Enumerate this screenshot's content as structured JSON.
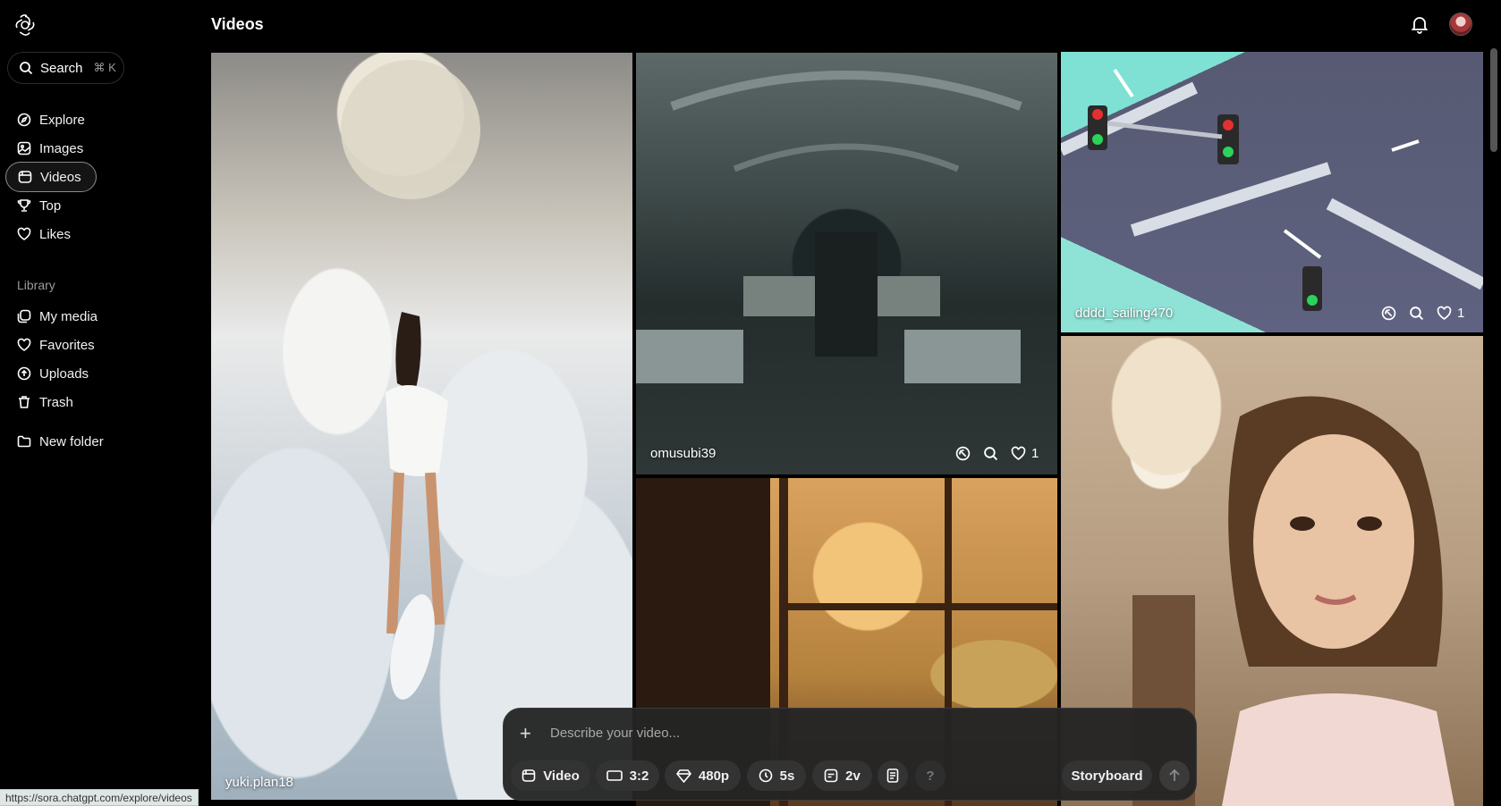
{
  "app": {
    "page_title": "Videos"
  },
  "search": {
    "label": "Search",
    "shortcut": "⌘ K"
  },
  "nav": {
    "items": [
      {
        "id": "explore",
        "label": "Explore",
        "icon": "compass-icon"
      },
      {
        "id": "images",
        "label": "Images",
        "icon": "image-icon"
      },
      {
        "id": "videos",
        "label": "Videos",
        "icon": "film-icon",
        "active": true
      },
      {
        "id": "top",
        "label": "Top",
        "icon": "trophy-icon"
      },
      {
        "id": "likes",
        "label": "Likes",
        "icon": "heart-icon"
      }
    ],
    "library_label": "Library",
    "library": [
      {
        "id": "my-media",
        "label": "My media",
        "icon": "media-icon"
      },
      {
        "id": "favorites",
        "label": "Favorites",
        "icon": "heart-icon"
      },
      {
        "id": "uploads",
        "label": "Uploads",
        "icon": "upload-icon"
      },
      {
        "id": "trash",
        "label": "Trash",
        "icon": "trash-icon"
      }
    ],
    "new_folder": {
      "label": "New folder",
      "icon": "folder-plus-icon"
    }
  },
  "tiles": [
    {
      "id": "clouds",
      "user": "yuki.plan18"
    },
    {
      "id": "hospital",
      "user": "omusubi39",
      "likes": "1"
    },
    {
      "id": "traffic",
      "user": "dddd_sailing470",
      "likes": "1"
    },
    {
      "id": "window",
      "user": ""
    },
    {
      "id": "portrait",
      "user": ""
    }
  ],
  "composer": {
    "placeholder": "Describe your video...",
    "chips": {
      "type": "Video",
      "aspect": "3:2",
      "resolution": "480p",
      "duration": "5s",
      "variations": "2v"
    },
    "help": "?",
    "storyboard": "Storyboard"
  },
  "status_url": "https://sora.chatgpt.com/explore/videos",
  "colors": {
    "background": "#000000",
    "accent_active_border": "#8a8a8a",
    "composer_bg": "#242424"
  }
}
